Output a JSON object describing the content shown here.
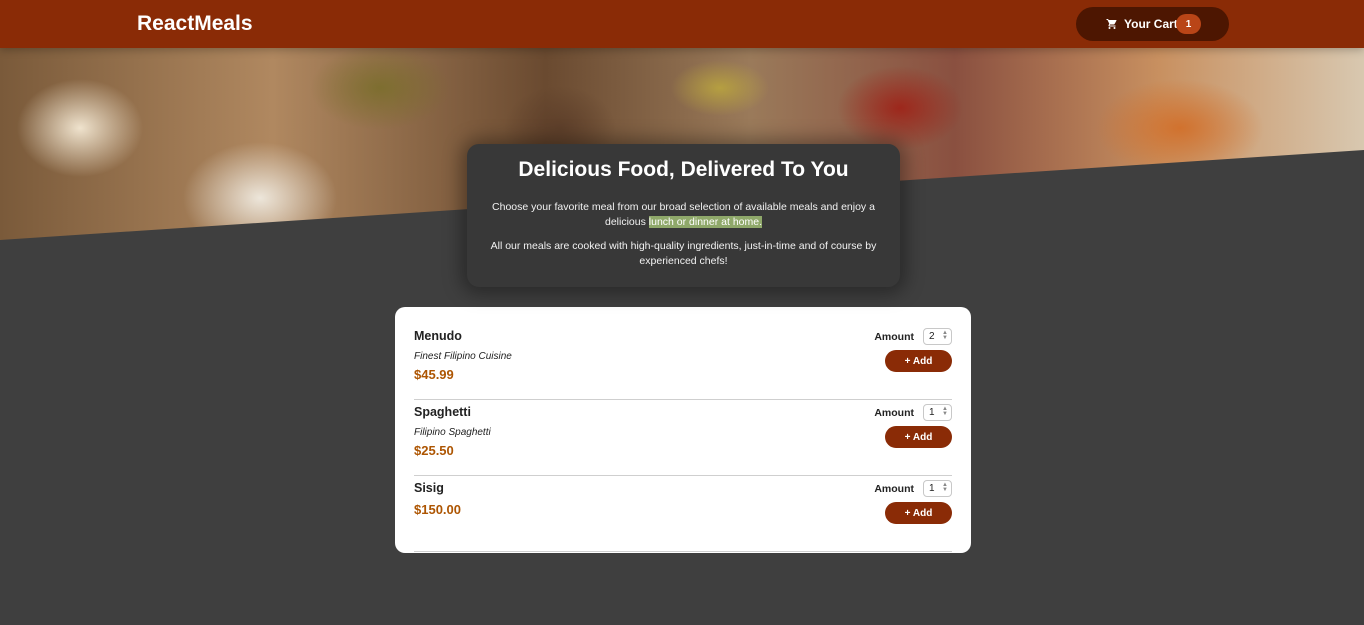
{
  "header": {
    "brand": "ReactMeals",
    "cart_label": "Your Cart",
    "cart_count": "1",
    "cart_icon": "cart-icon",
    "colors": {
      "header": "#8a2b06",
      "cart_button": "#4d1601",
      "badge": "#b94517"
    }
  },
  "summary": {
    "title": "Delicious Food, Delivered To You",
    "para1_pre": "Choose your favorite meal from our broad selection of available meals and enjoy a delicious",
    "para1_highlight": "lunch or dinner at home.",
    "para2": "All our meals are cooked with high-quality ingredients, just-in-time and of course by experienced chefs!"
  },
  "meals": [
    {
      "name": "Menudo",
      "description": "Finest Filipino Cuisine",
      "price": "$45.99",
      "amount_label": "Amount",
      "amount": "2",
      "add_label": "+ Add"
    },
    {
      "name": "Spaghetti",
      "description": "Filipino Spaghetti",
      "price": "$25.50",
      "amount_label": "Amount",
      "amount": "1",
      "add_label": "+ Add"
    },
    {
      "name": "Sisig",
      "description": "",
      "price": "$150.00",
      "amount_label": "Amount",
      "amount": "1",
      "add_label": "+ Add"
    }
  ],
  "colors": {
    "background": "#3f3f3f",
    "price": "#ad5502",
    "button": "#8a2b06"
  }
}
